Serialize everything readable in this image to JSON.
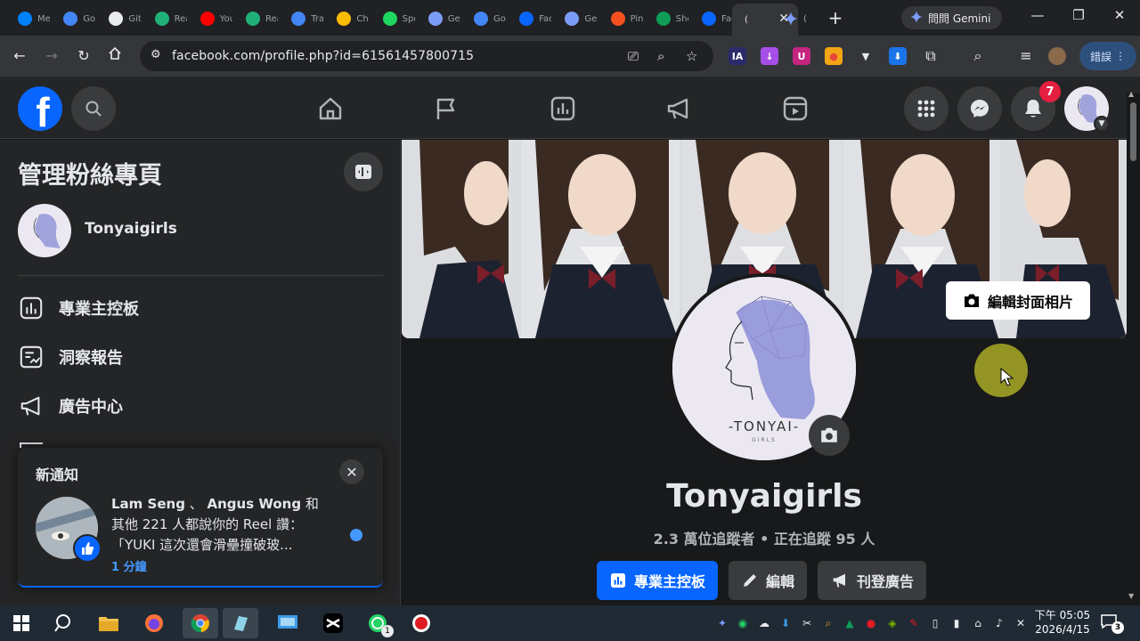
{
  "browser": {
    "tabs": [
      {
        "title": "Meta",
        "icon": "meta-icon",
        "color": "#0081fb"
      },
      {
        "title": "Google",
        "icon": "google-icon",
        "color": "#4285f4"
      },
      {
        "title": "GitHub",
        "icon": "github-icon",
        "color": "#e8eaed"
      },
      {
        "title": "Readwise",
        "icon": "r-icon",
        "color": "#1fb177"
      },
      {
        "title": "YouTube",
        "icon": "youtube-icon",
        "color": "#ff0000"
      },
      {
        "title": "Readwise",
        "icon": "r-icon",
        "color": "#1fb177"
      },
      {
        "title": "Translate",
        "icon": "translate-icon",
        "color": "#4285f4"
      },
      {
        "title": "Chrome",
        "icon": "chrome-icon",
        "color": "#fbbc04"
      },
      {
        "title": "Spotify",
        "icon": "spotify-icon",
        "color": "#1ed760"
      },
      {
        "title": "Gemini",
        "icon": "gemini-icon",
        "color": "#7b9cf7"
      },
      {
        "title": "Google",
        "icon": "google-icon",
        "color": "#4285f4"
      },
      {
        "title": "Facebook",
        "icon": "facebook-icon",
        "color": "#0866ff"
      },
      {
        "title": "Gemini",
        "icon": "gemini-icon",
        "color": "#7b9cf7"
      },
      {
        "title": "Pinwheel",
        "icon": "pinwheel-icon",
        "color": "#f4511e"
      },
      {
        "title": "Sheets",
        "icon": "plus-icon",
        "color": "#0f9d58"
      },
      {
        "title": "Facebook",
        "icon": "facebook-icon",
        "color": "#0866ff"
      }
    ],
    "active_tab": {
      "title": "(",
      "icon": "gemini-icon"
    },
    "gemini_button": "問問 Gemini",
    "url": "facebook.com/profile.php?id=61561457800715",
    "error_label": "錯誤",
    "extensions": [
      {
        "label": "IA",
        "color": "#2b2b6b",
        "text_color": "#ffffff"
      },
      {
        "label": "↓",
        "color": "#a64ee8",
        "text_color": "#ffffff"
      },
      {
        "label": "U",
        "color": "#c4257f",
        "text_color": "#ffffff"
      },
      {
        "label": "●",
        "color": "#f2a516",
        "text_color": "#e8453c"
      },
      {
        "label": "▼",
        "color": "#35363a",
        "text_color": "#e8eaed"
      },
      {
        "label": "⬇",
        "color": "#1a73e8",
        "text_color": "#ffffff"
      }
    ]
  },
  "fb": {
    "notification_count": "7",
    "left_panel": {
      "title": "管理粉絲專頁",
      "page_name": "Tonyaigirls",
      "items": [
        {
          "label": "專業主控板",
          "icon": "dashboard-icon"
        },
        {
          "label": "洞察報告",
          "icon": "insights-icon"
        },
        {
          "label": "廣告中心",
          "icon": "megaphone-icon"
        }
      ]
    },
    "toast": {
      "title": "新通知",
      "actor1": "Lam Seng",
      "sep": " 、 ",
      "actor2": "Angus Wong",
      "and": " 和",
      "rest": "其他 221 人都說你的 Reel 讚：「YUKI 這次還會滑壘撞破玻...",
      "time": "1 分鐘"
    },
    "profile": {
      "name": "Tonyaigirls",
      "stats": "2.3 萬位追蹤者 • 正在追蹤 95 人",
      "logo_text": "-TONYAI-",
      "logo_sub": "GIRLS",
      "edit_cover": "編輯封面相片",
      "actions": {
        "dashboard": "專業主控板",
        "edit": "編輯",
        "advertise": "刊登廣告"
      }
    }
  },
  "taskbar": {
    "time": "下午 05:05",
    "date": "2026/4/15",
    "whatsapp_badge": "1",
    "notif_count": "3"
  }
}
